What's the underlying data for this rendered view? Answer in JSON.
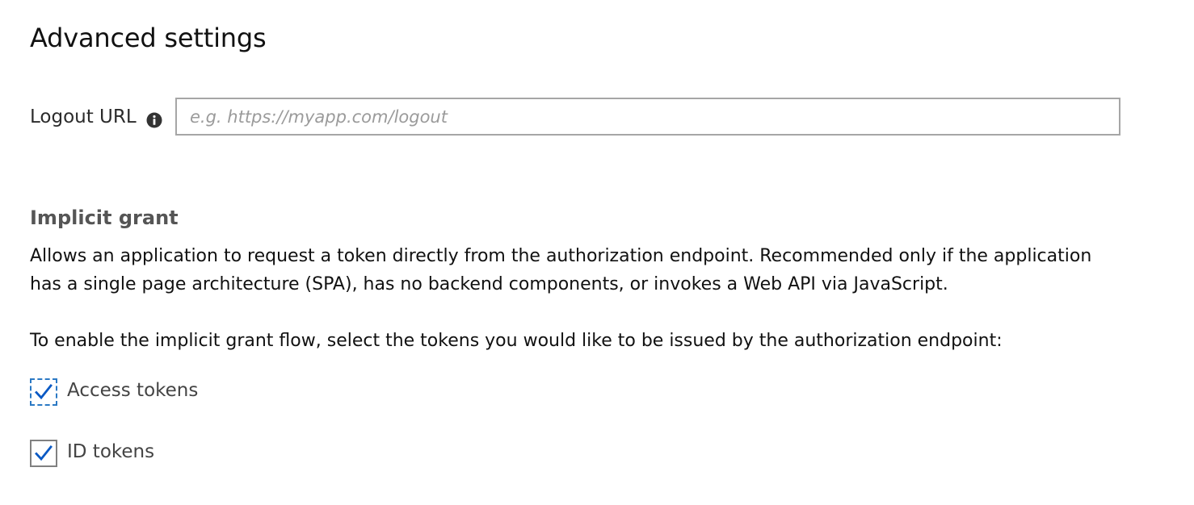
{
  "page": {
    "title": "Advanced settings"
  },
  "logout": {
    "label": "Logout URL",
    "info_icon": "info-circle-icon",
    "value": "",
    "placeholder": "e.g. https://myapp.com/logout"
  },
  "implicit_grant": {
    "heading": "Implicit grant",
    "description": "Allows an application to request a token directly from the authorization endpoint. Recommended only if the application has a single page architecture (SPA), has no backend components, or invokes a Web API via JavaScript.",
    "instruction": "To enable the implicit grant flow, select the tokens you would like to be issued by the authorization endpoint:",
    "options": [
      {
        "label": "Access tokens",
        "checked": true
      },
      {
        "label": "ID tokens",
        "checked": true
      }
    ]
  },
  "colors": {
    "checkmark": "#0a59c4",
    "focus_outline": "#2b79c4"
  }
}
